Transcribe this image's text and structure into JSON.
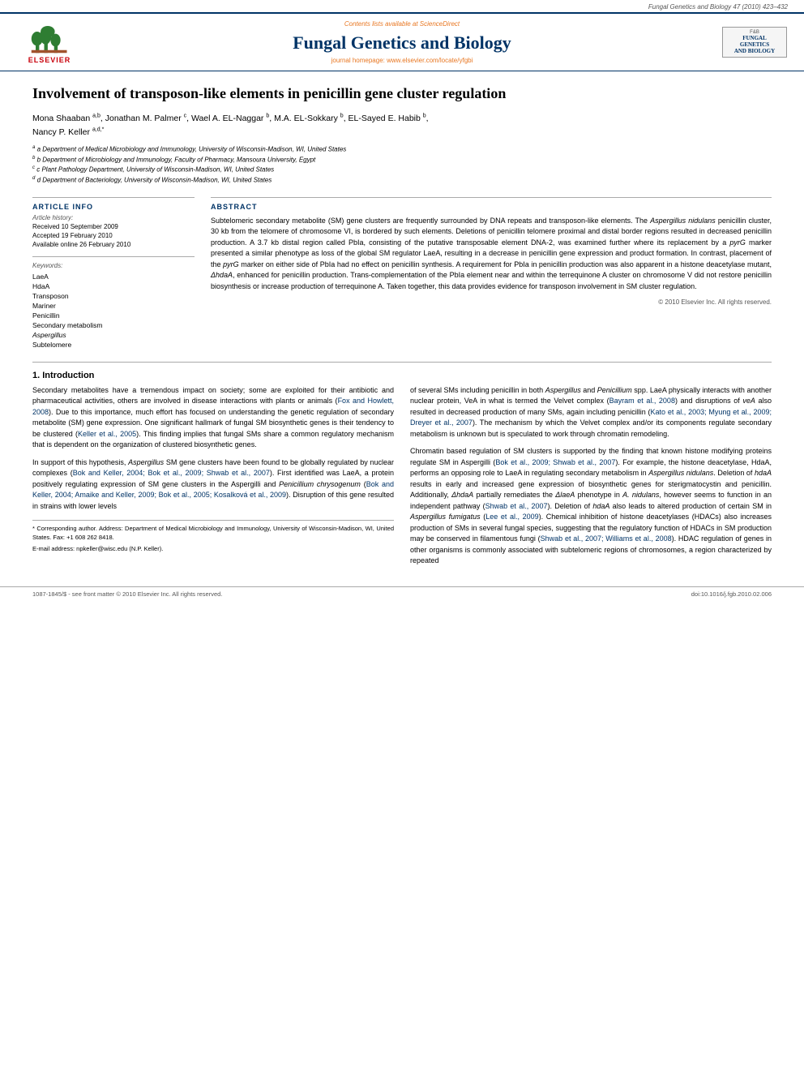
{
  "topbar": {
    "journal_ref": "Fungal Genetics and Biology 47 (2010) 423–432"
  },
  "journal_header": {
    "contents_text": "Contents lists available at",
    "sciencedirect": "ScienceDirect",
    "title": "Fungal Genetics and Biology",
    "homepage_text": "journal homepage: www.elsevier.com/locate/yfgbi",
    "elsevier_label": "ELSEVIER",
    "logo_title": "Fungal Genetics and Biology",
    "logo_subtitle": "FUNGAL GENETICS AND BIOLOGY"
  },
  "article": {
    "title": "Involvement of transposon-like elements in penicillin gene cluster regulation",
    "authors": "Mona Shaaban a,b, Jonathan M. Palmer c, Wael A. EL-Naggar b, M.A. EL-Sokkary b, EL-Sayed E. Habib b, Nancy P. Keller a,d,*",
    "affiliations": [
      "a Department of Medical Microbiology and Immunology, University of Wisconsin-Madison, WI, United States",
      "b Department of Microbiology and Immunology, Faculty of Pharmacy, Mansoura University, Egypt",
      "c Plant Pathology Department, University of Wisconsin-Madison, WI, United States",
      "d Department of Bacteriology, University of Wisconsin-Madison, WI, United States"
    ]
  },
  "article_info": {
    "section_label": "ARTICLE INFO",
    "history_label": "Article history:",
    "received": "Received 10 September 2009",
    "accepted": "Accepted 19 February 2010",
    "available": "Available online 26 February 2010",
    "keywords_label": "Keywords:",
    "keywords": [
      "LaeA",
      "HdaA",
      "Transposon",
      "Mariner",
      "Penicillin",
      "Secondary metabolism",
      "Aspergillus",
      "Subtelomere"
    ]
  },
  "abstract": {
    "section_label": "ABSTRACT",
    "text": "Subtelomeric secondary metabolite (SM) gene clusters are frequently surrounded by DNA repeats and transposon-like elements. The Aspergillus nidulans penicillin cluster, 30 kb from the telomere of chromosome VI, is bordered by such elements. Deletions of penicillin telomere proximal and distal border regions resulted in decreased penicillin production. A 3.7 kb distal region called PbIa, consisting of the putative transposable element DNA-2, was examined further where its replacement by a pyrG marker presented a similar phenotype as loss of the global SM regulator LaeA, resulting in a decrease in penicillin gene expression and product formation. In contrast, placement of the pyrG marker on either side of PbIa had no effect on penicillin synthesis. A requirement for PbIa in penicillin production was also apparent in a histone deacetylase mutant, ΔhdaA, enhanced for penicillin production. Trans-complementation of the PbIa element near and within the terrequinone A cluster on chromosome V did not restore penicillin biosynthesis or increase production of terrequinone A. Taken together, this data provides evidence for transposon involvement in SM cluster regulation.",
    "copyright": "© 2010 Elsevier Inc. All rights reserved."
  },
  "introduction": {
    "section_number": "1.",
    "section_title": "Introduction",
    "para1": "Secondary metabolites have a tremendous impact on society; some are exploited for their antibiotic and pharmaceutical activities, others are involved in disease interactions with plants or animals (Fox and Howlett, 2008). Due to this importance, much effort has focused on understanding the genetic regulation of secondary metabolite (SM) gene expression. One significant hallmark of fungal SM biosynthetic genes is their tendency to be clustered (Keller et al., 2005). This finding implies that fungal SMs share a common regulatory mechanism that is dependent on the organization of clustered biosynthetic genes.",
    "para2": "In support of this hypothesis, Aspergillus SM gene clusters have been found to be globally regulated by nuclear complexes (Bok and Keller, 2004; Bok et al., 2009; Shwab et al., 2007). First identified was LaeA, a protein positively regulating expression of SM gene clusters in the Aspergilli and Penicillium chrysogenum (Bok and Keller, 2004; Amaike and Keller, 2009; Bok et al., 2005; Kosalková et al., 2009). Disruption of this gene resulted in strains with lower levels"
  },
  "right_col": {
    "para1": "of several SMs including penicillin in both Aspergillus and Penicillium spp. LaeA physically interacts with another nuclear protein, VeA in what is termed the Velvet complex (Bayram et al., 2008) and disruptions of veA also resulted in decreased production of many SMs, again including penicillin (Kato et al., 2003; Myung et al., 2009; Dreyer et al., 2007). The mechanism by which the Velvet complex and/or its components regulate secondary metabolism is unknown but is speculated to work through chromatin remodeling.",
    "para2": "Chromatin based regulation of SM clusters is supported by the finding that known histone modifying proteins regulate SM in Aspergilli (Bok et al., 2009; Shwab et al., 2007). For example, the histone deacetylase, HdaA, performs an opposing role to LaeA in regulating secondary metabolism in Aspergillus nidulans. Deletion of hdaA results in early and increased gene expression of biosynthetic genes for sterigmatocystin and penicillin. Additionally, ΔhdaA partially remediates the ΔlaeA phenotype in A. nidulans, however seems to function in an independent pathway (Shwab et al., 2007). Deletion of hdaA also leads to altered production of certain SM in Aspergillus fumigatus (Lee et al., 2009). Chemical inhibition of histone deacetylases (HDACs) also increases production of SMs in several fungal species, suggesting that the regulatory function of HDACs in SM production may be conserved in filamentous fungi (Shwab et al., 2007; Williams et al., 2008). HDAC regulation of genes in other organisms is commonly associated with subtelomeric regions of chromosomes, a region characterized by repeated"
  },
  "footnotes": {
    "corresponding": "* Corresponding author. Address: Department of Medical Microbiology and Immunology, University of Wisconsin-Madison, WI, United States. Fax: +1 608 262 8418.",
    "email": "E-mail address: npkeller@wisc.edu (N.P. Keller)."
  },
  "bottom_bar": {
    "issn": "1087-1845/$ - see front matter © 2010 Elsevier Inc. All rights reserved.",
    "doi": "doi:10.1016/j.fgb.2010.02.006"
  }
}
